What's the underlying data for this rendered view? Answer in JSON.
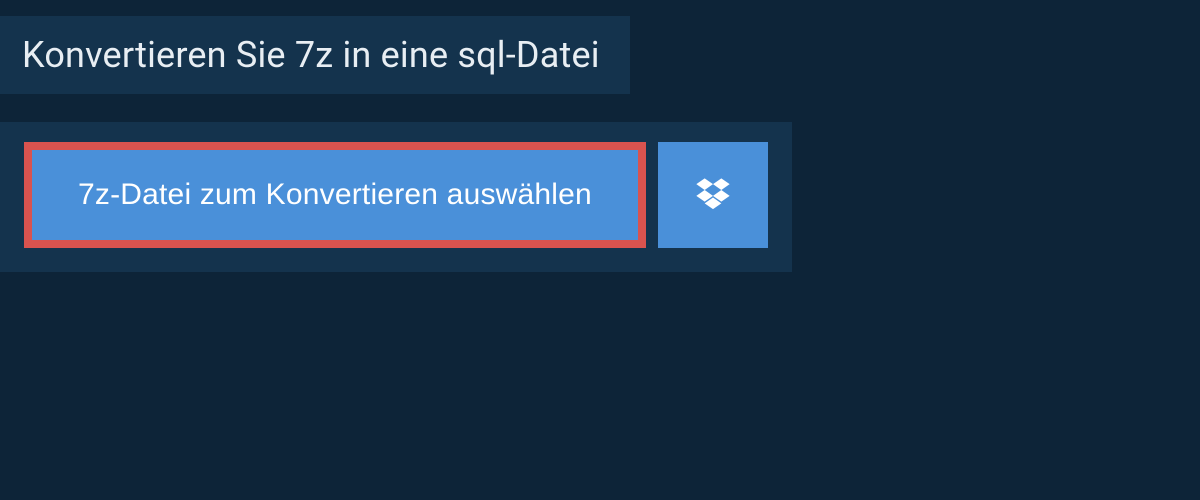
{
  "header": {
    "title": "Konvertieren Sie 7z in eine sql-Datei"
  },
  "upload": {
    "select_file_label": "7z-Datei zum Konvertieren auswählen",
    "dropbox_icon": "dropbox-icon"
  },
  "colors": {
    "page_bg": "#0d2438",
    "panel_bg": "#14334d",
    "button_bg": "#4a90d9",
    "highlight_border": "#d9534f",
    "text_light": "#e8eef3",
    "text_white": "#ffffff"
  }
}
